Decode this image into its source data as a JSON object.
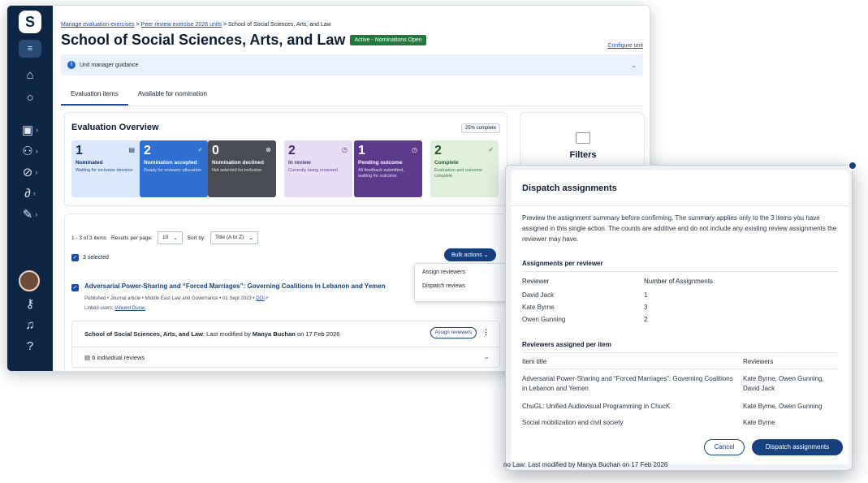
{
  "breadcrumb": {
    "items": [
      "Manage evaluation exercises",
      "Peer review exercise 2026 units",
      "School of Social Sciences, Arts, and Law"
    ],
    "sep": ">"
  },
  "page": {
    "title": "School of Social Sciences, Arts, and Law",
    "status": "Active - Nominations Open",
    "configure_link": "Configure unit",
    "guidance": "Unit manager guidance"
  },
  "tabs": [
    "Evaluation items",
    "Available for nomination"
  ],
  "overview": {
    "title": "Evaluation Overview",
    "complete_badge": "25% complete",
    "stats": [
      {
        "num": "1",
        "label": "Nominated",
        "sub": "Waiting for inclusion decision",
        "bg": "#dbe8fb",
        "fg": "#0f2d66"
      },
      {
        "num": "2",
        "label": "Nomination accepted",
        "sub": "Ready for reviewer allocation",
        "bg": "#2e6fd1",
        "fg": "#ffffff"
      },
      {
        "num": "0",
        "label": "Nomination declined",
        "sub": "Not selected for inclusion",
        "bg": "#4a4d55",
        "fg": "#ffffff"
      },
      {
        "num": "2",
        "label": "In review",
        "sub": "Currently being reviewed",
        "bg": "#e6dcf3",
        "fg": "#4b2a7e"
      },
      {
        "num": "1",
        "label": "Pending outcome",
        "sub": "All feedback submitted, waiting for outcome",
        "bg": "#5c3a8c",
        "fg": "#ffffff"
      },
      {
        "num": "2",
        "label": "Complete",
        "sub": "Evaluation and outcome complete",
        "bg": "#e0f0dd",
        "fg": "#1f5a2a"
      }
    ]
  },
  "filters": {
    "title": "Filters"
  },
  "results": {
    "count": "1 - 3 of 3 items",
    "per_page_label": "Results per page:",
    "per_page": "10",
    "sort_label": "Sort by:",
    "sort_value": "Title (A to Z)",
    "selected": "3 selected",
    "bulk_actions": "Bulk actions",
    "bulk_menu": [
      "Assign reviewers",
      "Dispatch reviews"
    ]
  },
  "item": {
    "title": "Adversarial Power-Sharing and “Forced Marriages”: Governing Coalitions in Lebanon and Yemen",
    "meta": "Published • Journal article • Middle East Law and Governance • 01 Sept 2023 •",
    "doi": "DOI",
    "linked_label": "Linked users:",
    "linked_user": "Vincent Durac",
    "unit_name": "School of Social Sciences, Arts, and Law",
    "modified_text": ": Last modified by",
    "modified_by": "Manya Buchan",
    "modified_on": "on 17 Feb 2026",
    "assign_button": "Assign reviewers",
    "reviews": "6 individual reviews"
  },
  "modal": {
    "title": "Dispatch assignments",
    "description": "Preview the assignment summary before confirming. The summary applies only to the 3 items you have assigned in this single action. The counts are additive and do not include any existing review assignments the reviewer may have.",
    "per_reviewer_heading": "Assignments per reviewer",
    "col_reviewer": "Reviewer",
    "col_count": "Number of Assignments",
    "reviewers": [
      {
        "name": "David Jack",
        "count": "1"
      },
      {
        "name": "Kate Byrne",
        "count": "3"
      },
      {
        "name": "Owen Gunning",
        "count": "2"
      }
    ],
    "per_item_heading": "Reviewers assigned per item",
    "col_item": "Item title",
    "col_reviewers": "Reviewers",
    "items": [
      {
        "title": "Adversarial Power-Sharing and “Forced Marriages”: Governing Coalitions in Lebanon and Yemen",
        "reviewers": "Kate Byrne, Owen Gunning, David Jack"
      },
      {
        "title": "ChuGL: Unified Audiovisual Programming in ChucK",
        "reviewers": "Kate Byrne, Owen Gunning"
      },
      {
        "title": "Social mobilization and civil society",
        "reviewers": "Kate Byrne"
      }
    ],
    "cancel": "Cancel",
    "confirm": "Dispatch assignments"
  },
  "peek": {
    "bottom_text": "no Law: Last modified by Manya Buchan on 17 Feb 2026"
  }
}
